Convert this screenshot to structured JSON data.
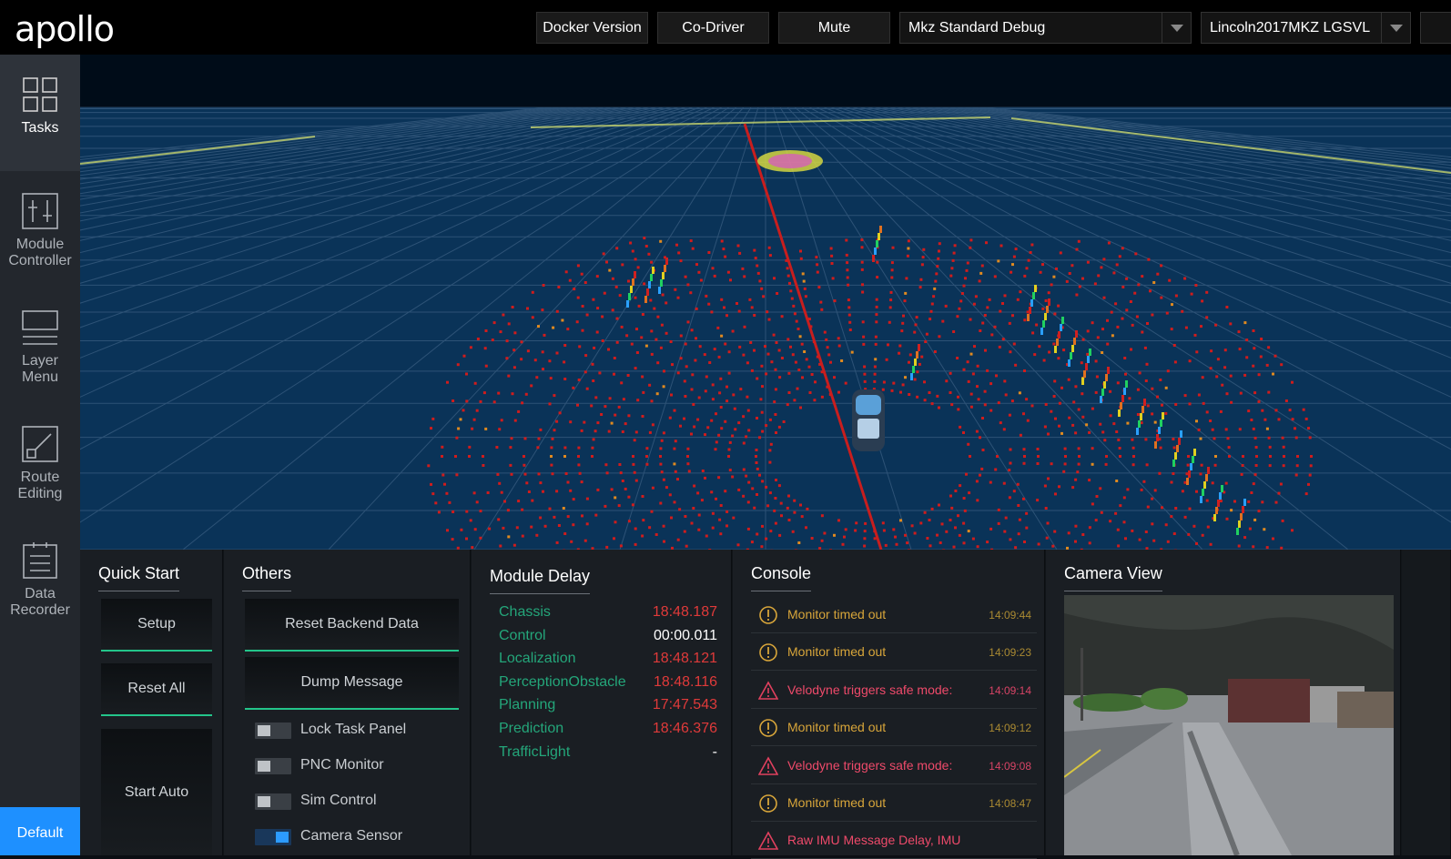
{
  "header": {
    "logo": "apollo",
    "buttons": [
      "Docker Version",
      "Co-Driver",
      "Mute"
    ],
    "mode_select": "Mkz Standard Debug",
    "vehicle_select": "Lincoln2017MKZ LGSVL"
  },
  "sidebar": {
    "items": [
      {
        "line1": "Tasks",
        "line2": "",
        "icon": "grid-icon"
      },
      {
        "line1": "Module",
        "line2": "Controller",
        "icon": "sliders-icon"
      },
      {
        "line1": "Layer",
        "line2": "Menu",
        "icon": "layers-icon"
      },
      {
        "line1": "Route",
        "line2": "Editing",
        "icon": "route-icon"
      },
      {
        "line1": "Data",
        "line2": "Recorder",
        "icon": "document-icon"
      }
    ],
    "default_button": "Default"
  },
  "quick_start": {
    "title": "Quick Start",
    "buttons": [
      "Setup",
      "Reset All",
      "Start Auto"
    ]
  },
  "others": {
    "title": "Others",
    "buttons": [
      "Reset Backend Data",
      "Dump Message"
    ],
    "toggles": [
      {
        "label": "Lock Task Panel",
        "on": false
      },
      {
        "label": "PNC Monitor",
        "on": false
      },
      {
        "label": "Sim Control",
        "on": false
      },
      {
        "label": "Camera Sensor",
        "on": true
      }
    ]
  },
  "module_delay": {
    "title": "Module Delay",
    "rows": [
      {
        "name": "Chassis",
        "value": "18:48.187",
        "status": "error"
      },
      {
        "name": "Control",
        "value": "00:00.011",
        "status": "ok"
      },
      {
        "name": "Localization",
        "value": "18:48.121",
        "status": "error"
      },
      {
        "name": "PerceptionObstacle",
        "value": "18:48.116",
        "status": "error"
      },
      {
        "name": "Planning",
        "value": "17:47.543",
        "status": "error"
      },
      {
        "name": "Prediction",
        "value": "18:46.376",
        "status": "error"
      },
      {
        "name": "TrafficLight",
        "value": "-",
        "status": "ok"
      }
    ]
  },
  "console": {
    "title": "Console",
    "messages": [
      {
        "level": "warn",
        "text": "Monitor timed out",
        "time": "14:09:44"
      },
      {
        "level": "warn",
        "text": "Monitor timed out",
        "time": "14:09:23"
      },
      {
        "level": "error",
        "text": "Velodyne triggers safe mode:",
        "time": "14:09:14"
      },
      {
        "level": "warn",
        "text": "Monitor timed out",
        "time": "14:09:12"
      },
      {
        "level": "error",
        "text": "Velodyne triggers safe mode:",
        "time": "14:09:08"
      },
      {
        "level": "warn",
        "text": "Monitor timed out",
        "time": "14:08:47"
      },
      {
        "level": "error",
        "text": "Raw IMU Message Delay, IMU",
        "time": ""
      }
    ]
  },
  "camera_view": {
    "title": "Camera View"
  },
  "colors": {
    "accent_green": "#23c58a",
    "error_red": "#e03a3a",
    "warn_yellow": "#d7a53a",
    "scene_bg": "#071a30",
    "default_blue": "#1e90ff"
  }
}
